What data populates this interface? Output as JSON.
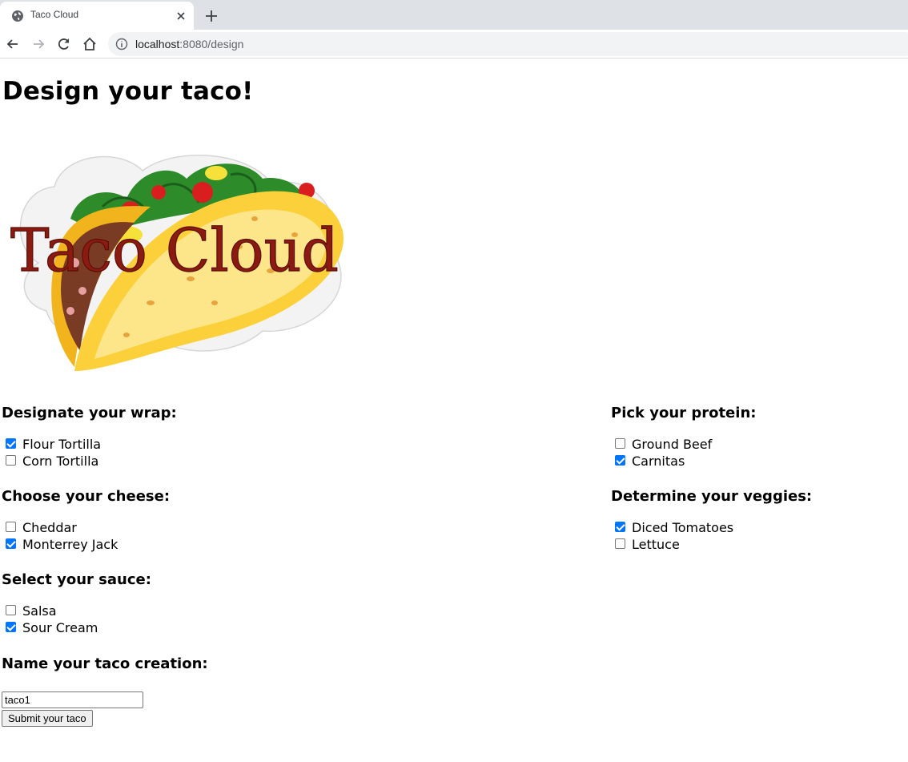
{
  "browser": {
    "tab_title": "Taco Cloud",
    "url_host": "localhost",
    "url_rest": ":8080/design"
  },
  "page": {
    "title": "Design your taco!",
    "logo_text": "Taco Cloud"
  },
  "groups": {
    "wrap": {
      "heading": "Designate your wrap:",
      "options": [
        {
          "label": "Flour Tortilla",
          "checked": true
        },
        {
          "label": "Corn Tortilla",
          "checked": false
        }
      ]
    },
    "cheese": {
      "heading": "Choose your cheese:",
      "options": [
        {
          "label": "Cheddar",
          "checked": false
        },
        {
          "label": "Monterrey Jack",
          "checked": true
        }
      ]
    },
    "sauce": {
      "heading": "Select your sauce:",
      "options": [
        {
          "label": "Salsa",
          "checked": false
        },
        {
          "label": "Sour Cream",
          "checked": true
        }
      ]
    },
    "protein": {
      "heading": "Pick your protein:",
      "options": [
        {
          "label": "Ground Beef",
          "checked": false
        },
        {
          "label": "Carnitas",
          "checked": true
        }
      ]
    },
    "veggies": {
      "heading": "Determine your veggies:",
      "options": [
        {
          "label": "Diced Tomatoes",
          "checked": true
        },
        {
          "label": "Lettuce",
          "checked": false
        }
      ]
    }
  },
  "form": {
    "name_heading": "Name your taco creation:",
    "name_value": "taco1",
    "submit_label": "Submit your taco"
  },
  "colors": {
    "checkbox_accent": "#0075ff",
    "logo_text": "#8b1a10"
  }
}
